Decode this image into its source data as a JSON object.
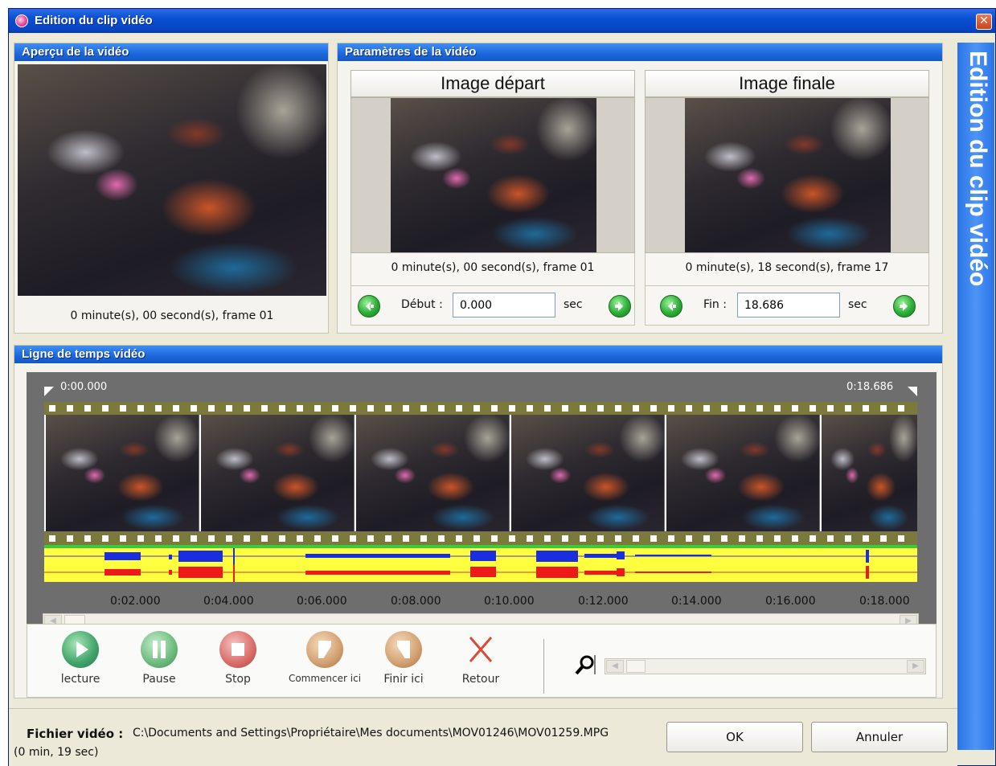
{
  "window": {
    "title": "Edition du clip vidéo",
    "close_glyph": "✕"
  },
  "preview": {
    "header": "Aperçu de la vidéo",
    "time": "0 minute(s), 00 second(s), frame 01"
  },
  "params": {
    "header": "Paramètres de la vidéo",
    "start": {
      "title": "Image départ",
      "time": "0 minute(s), 00 second(s), frame 01",
      "label": "Début :",
      "value": "0.000",
      "unit": "sec"
    },
    "end": {
      "title": "Image finale",
      "time": "0 minute(s), 18 second(s), frame 17",
      "label": "Fin :",
      "value": "18.686",
      "unit": "sec"
    }
  },
  "timeline": {
    "header": "Ligne de temps vidéo",
    "start_time": "0:00.000",
    "end_time": "0:18.686",
    "ticks": [
      "0:02.000",
      "0:04.000",
      "0:06.000",
      "0:08.000",
      "0:10.000",
      "0:12.000",
      "0:14.000",
      "0:16.000",
      "0:18.000"
    ]
  },
  "controls": {
    "play": "lecture",
    "pause": "Pause",
    "stop": "Stop",
    "start_here": "Commencer ici",
    "end_here": "Finir ici",
    "back": "Retour"
  },
  "footer": {
    "file_label": "Fichier vidéo :",
    "file_path": "C:\\Documents and Settings\\Propriétaire\\Mes documents\\MOV01246\\MOV01259.MPG",
    "duration": "(0 min, 19 sec)",
    "ok": "OK",
    "cancel": "Annuler"
  },
  "side_banner": "Edition du clip vidéo",
  "colors": {
    "accent": "#1b67dc",
    "wave_bg": "#ffff40",
    "wave_left": "#1a2ee0",
    "wave_right": "#ee1a1a"
  },
  "icons": [
    "app-icon",
    "close-icon",
    "arrow-left-icon",
    "arrow-right-icon",
    "play-icon",
    "pause-icon",
    "stop-icon",
    "start-here-icon",
    "end-here-icon",
    "back-icon",
    "zoom-icon"
  ]
}
